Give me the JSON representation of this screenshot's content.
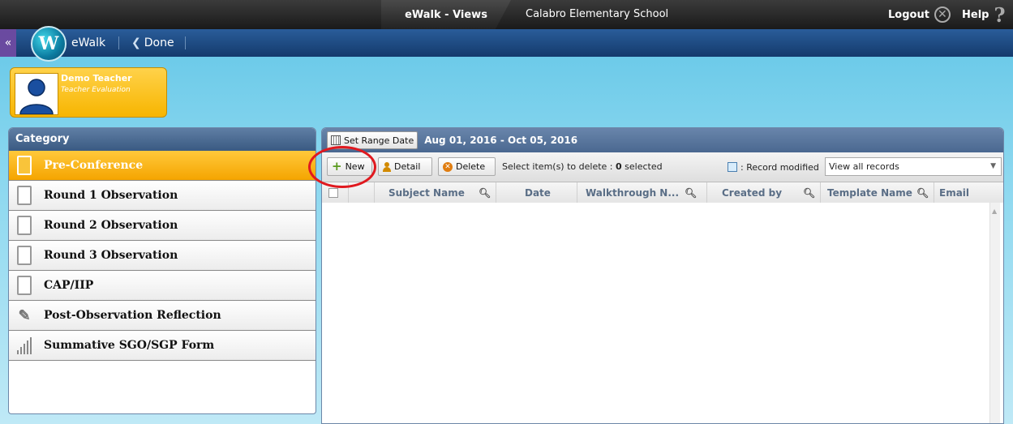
{
  "topbar": {
    "active_tab": "eWalk - Views",
    "school": "Calabro Elementary School",
    "logout_label": "Logout",
    "help_label": "Help"
  },
  "navbar": {
    "app_name": "eWalk",
    "done_label": "Done"
  },
  "teacher": {
    "name": "Demo Teacher",
    "role": "Teacher Evaluation"
  },
  "category": {
    "title": "Category",
    "items": [
      {
        "label": "Pre-Conference",
        "icon": "document-icon",
        "active": true
      },
      {
        "label": "Round 1 Observation",
        "icon": "document-icon"
      },
      {
        "label": "Round 2 Observation",
        "icon": "document-icon"
      },
      {
        "label": "Round 3 Observation",
        "icon": "document-icon"
      },
      {
        "label": "CAP/IIP",
        "icon": "document-icon"
      },
      {
        "label": "Post-Observation Reflection",
        "icon": "pencil-icon"
      },
      {
        "label": "Summative SGO/SGP Form",
        "icon": "bar-chart-icon"
      }
    ]
  },
  "range": {
    "button_label": "Set Range Date",
    "text": "Aug 01, 2016 - Oct 05, 2016"
  },
  "toolbar": {
    "new_label": "New",
    "detail_label": "Detail",
    "delete_label": "Delete",
    "select_info_prefix": "Select item(s) to delete : ",
    "select_count": "0",
    "select_info_suffix": " selected",
    "modified_label": ": Record modified",
    "view_select": "View all records"
  },
  "grid": {
    "columns": [
      "Subject Name",
      "Date",
      "Walkthrough N...",
      "Created by",
      "Template Name",
      "Email"
    ]
  },
  "colors": {
    "accent": "#f5a500",
    "header_blue": "#4a6890",
    "highlight": "#e0191f"
  }
}
